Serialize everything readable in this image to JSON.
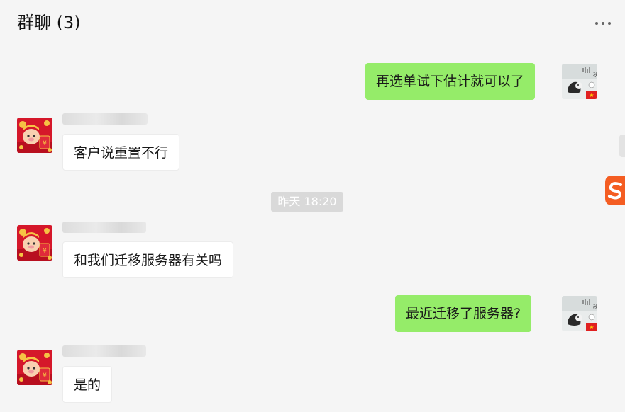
{
  "header": {
    "title": "群聊 (3)",
    "more_icon": "more-dots-icon"
  },
  "timestamp": "昨天 18:20",
  "messages": [
    {
      "direction": "out",
      "text": "再选单试下估计就可以了"
    },
    {
      "direction": "in",
      "text": "客户说重置不行"
    },
    {
      "direction": "in",
      "text": "和我们迁移服务器有关吗"
    },
    {
      "direction": "out",
      "text": "最近迁移了服务器?"
    },
    {
      "direction": "in",
      "text": "是的"
    }
  ],
  "colors": {
    "outgoing_bubble": "#95ec69",
    "incoming_bubble": "#ffffff",
    "background": "#f5f5f5",
    "accent_ime": "#f45d22"
  }
}
